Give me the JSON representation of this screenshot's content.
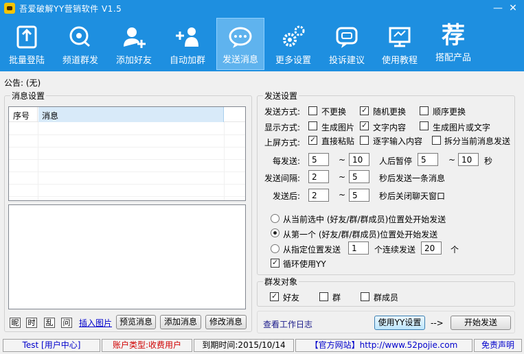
{
  "window": {
    "title": "吾爱破解YY营销软件 V1.5",
    "minimize": "—",
    "close": "✕"
  },
  "toolbar": {
    "items": [
      {
        "label": "批量登陆",
        "icon": "batch-login-icon"
      },
      {
        "label": "频道群发",
        "icon": "channel-broadcast-icon"
      },
      {
        "label": "添加好友",
        "icon": "add-friend-icon"
      },
      {
        "label": "自动加群",
        "icon": "auto-join-group-icon"
      },
      {
        "label": "发送消息",
        "icon": "send-message-icon"
      },
      {
        "label": "更多设置",
        "icon": "gears-icon"
      },
      {
        "label": "投诉建议",
        "icon": "feedback-icon"
      },
      {
        "label": "使用教程",
        "icon": "tutorial-icon"
      },
      {
        "label": "搭配产品",
        "icon": "products-icon"
      }
    ],
    "products_glyph": "荐"
  },
  "notice": {
    "label": "公告:",
    "value": "(无)"
  },
  "message_settings": {
    "legend": "消息设置",
    "columns": [
      "序号",
      "消息"
    ],
    "format_buttons": [
      "昵",
      "时",
      "乱",
      "问"
    ],
    "insert_image": "插入图片",
    "preview": "预览消息",
    "add": "添加消息",
    "edit": "修改消息"
  },
  "send_settings": {
    "legend": "发送设置",
    "mode_label": "发送方式:",
    "mode_options": [
      {
        "label": "不更换",
        "checked": false
      },
      {
        "label": "随机更换",
        "checked": true
      },
      {
        "label": "顺序更换",
        "checked": false
      }
    ],
    "display_label": "显示方式:",
    "display_options": [
      {
        "label": "生成图片",
        "checked": false
      },
      {
        "label": "文字内容",
        "checked": true
      },
      {
        "label": "生成图片或文字",
        "checked": false
      }
    ],
    "screen_label": "上屏方式:",
    "screen_options": [
      {
        "label": "直接粘贴",
        "checked": true
      },
      {
        "label": "逐字输入内容",
        "checked": false
      },
      {
        "label": "拆分当前消息发送",
        "checked": false
      }
    ],
    "per_send_label": "每发送:",
    "per_send_from": "5",
    "per_send_to": "10",
    "pause_label": "人后暂停",
    "pause_from": "5",
    "pause_to": "10",
    "seconds": "秒",
    "tilde": "~",
    "interval_label": "发送间隔:",
    "interval_from": "2",
    "interval_to": "5",
    "interval_suffix": "秒后发送一条消息",
    "after_label": "发送后:",
    "after_from": "2",
    "after_to": "5",
    "after_suffix": "秒后关闭聊天窗口",
    "start_options": [
      {
        "label": "从当前选中 (好友/群/群成员)位置处开始发送",
        "checked": false
      },
      {
        "label": "从第一个 (好友/群/群成员)位置处开始发送",
        "checked": true
      },
      {
        "label": "从指定位置发送",
        "checked": false
      }
    ],
    "specified_pos": "1",
    "continuous_label": "个连续发送",
    "continuous_count": "20",
    "unit": "个",
    "loop_label": "循环使用YY",
    "loop_checked": true
  },
  "targets": {
    "legend": "群发对象",
    "options": [
      {
        "label": "好友",
        "checked": true
      },
      {
        "label": "群",
        "checked": false
      },
      {
        "label": "群成员",
        "checked": false
      }
    ]
  },
  "actions": {
    "view_log": "查看工作日志",
    "use_yy_settings": "使用YY设置",
    "arrow": "-->",
    "start_send": "开始发送"
  },
  "statusbar": {
    "user": "Test [用户中心]",
    "account_type": "账户类型:收费用户",
    "expiry": "到期时间:2015/10/14",
    "website": "【官方网站】http://www.52pojie.com",
    "disclaimer": "免责声明"
  },
  "colors": {
    "toolbar_bg": "#1e8fe0",
    "active_tab": "#5fb3ee",
    "account_type_text": "#d00000",
    "link_text": "#0000cc"
  }
}
